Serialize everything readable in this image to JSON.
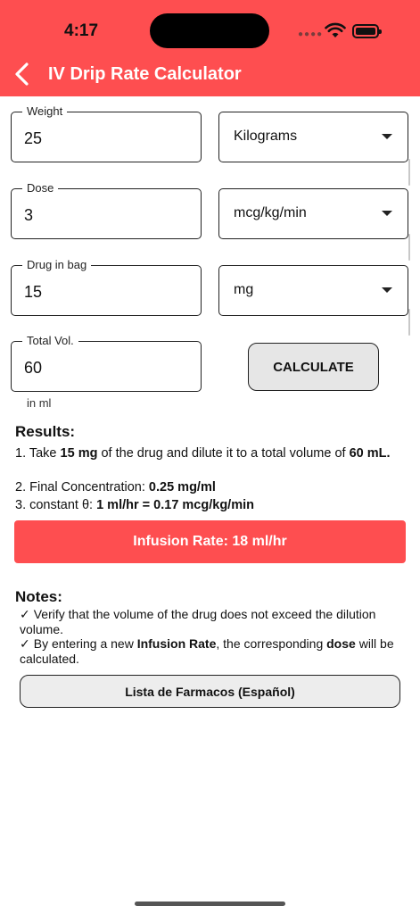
{
  "status_bar": {
    "time": "4:17"
  },
  "header": {
    "title": "IV Drip Rate Calculator"
  },
  "form": {
    "weight": {
      "label": "Weight",
      "value": "25",
      "unit": "Kilograms"
    },
    "dose": {
      "label": "Dose",
      "value": "3",
      "unit": "mcg/kg/min"
    },
    "drug": {
      "label": "Drug in bag",
      "value": "15",
      "unit": "mg"
    },
    "volume": {
      "label": "Total Vol.",
      "value": "60",
      "hint": "in ml"
    },
    "calculate_label": "CALCULATE"
  },
  "results": {
    "title": "Results:",
    "line1": {
      "prefix": "1. Take ",
      "amount": "15 mg",
      "mid": " of the drug and dilute it to a total volume of ",
      "volume": "60 mL."
    },
    "line2": {
      "prefix": "2. Final Concentration: ",
      "value": "0.25 mg/ml"
    },
    "line3": {
      "prefix": "3. constant θ: ",
      "value": "1 ml/hr = 0.17 mcg/kg/min"
    },
    "infusion_label": "Infusion Rate: 18 ml/hr"
  },
  "notes": {
    "title": "Notes:",
    "check": "✓",
    "note1": "Verify that the volume of the drug does not exceed the dilution volume.",
    "note2": {
      "prefix": "By entering a new ",
      "bold1": "Infusion Rate",
      "mid": ", the corresponding ",
      "bold2": "dose",
      "suffix": " will be calculated."
    }
  },
  "list_button": "Lista de Farmacos (Español)",
  "colors": {
    "accent": "#fe4e50"
  }
}
